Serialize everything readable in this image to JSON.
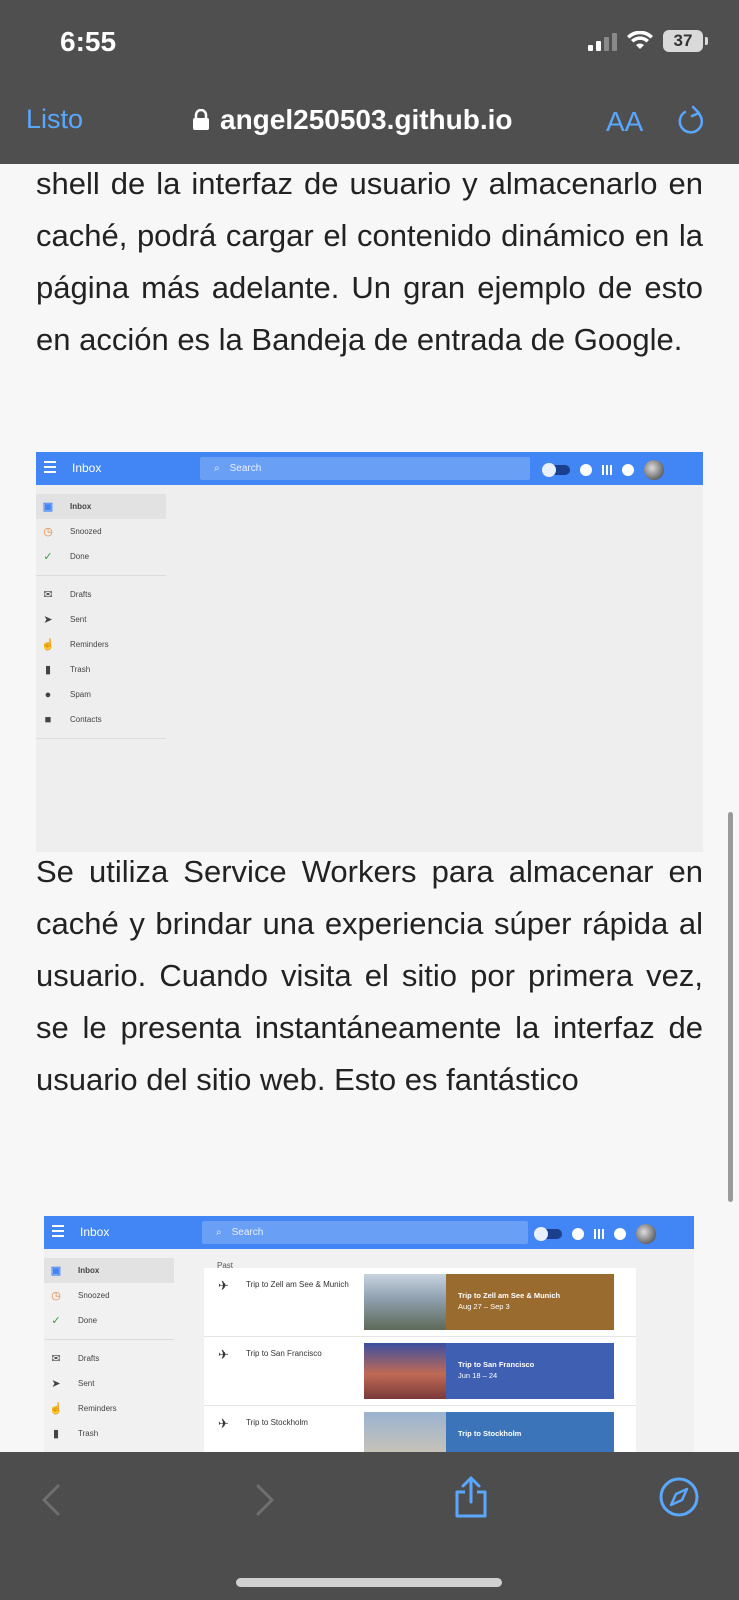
{
  "status_bar": {
    "time": "6:55",
    "battery": "37"
  },
  "browser": {
    "done_label": "Listo",
    "url": "angel250503.github.io",
    "text_size_label": "AA"
  },
  "article": {
    "para1": "shell de la interfaz de usuario y almacenarlo en caché, podrá cargar el contenido dinámico en la página más adelante. Un gran ejemplo de esto en acción es la Bandeja de entrada de Google.",
    "para2": "Se utiliza Service Workers para almacenar en caché y brindar una experiencia súper rápida al usuario. Cuando visita el sitio por primera vez, se le presenta instantáneamente la interfaz de usuario del sitio web. Esto es fantástico"
  },
  "inbox_screenshot_1": {
    "title": "Inbox",
    "search_placeholder": "Search",
    "nav": [
      {
        "label": "Inbox",
        "icon": "inbox-icon"
      },
      {
        "label": "Snoozed",
        "icon": "clock-icon"
      },
      {
        "label": "Done",
        "icon": "check-icon"
      },
      {
        "label": "Drafts",
        "icon": "drafts-icon"
      },
      {
        "label": "Sent",
        "icon": "send-icon"
      },
      {
        "label": "Reminders",
        "icon": "reminder-icon"
      },
      {
        "label": "Trash",
        "icon": "trash-icon"
      },
      {
        "label": "Spam",
        "icon": "spam-icon"
      },
      {
        "label": "Contacts",
        "icon": "contacts-icon"
      }
    ]
  },
  "inbox_screenshot_2": {
    "title": "Inbox",
    "search_placeholder": "Search",
    "nav": [
      {
        "label": "Inbox"
      },
      {
        "label": "Snoozed"
      },
      {
        "label": "Done"
      },
      {
        "label": "Drafts"
      },
      {
        "label": "Sent"
      },
      {
        "label": "Reminders"
      },
      {
        "label": "Trash"
      }
    ],
    "section_label": "Past",
    "trips": [
      {
        "name": "Trip to Zell am See & Munich",
        "card_title": "Trip to Zell am See & Munich",
        "card_dates": "Aug 27 – Sep 3",
        "card_color": "#9a6b2e"
      },
      {
        "name": "Trip to San Francisco",
        "card_title": "Trip to San Francisco",
        "card_dates": "Jun 18 – 24",
        "card_color": "#3f5fb3"
      },
      {
        "name": "Trip to Stockholm",
        "card_title": "Trip to Stockholm",
        "card_dates": "",
        "card_color": "#3b74b8"
      }
    ]
  },
  "colors": {
    "accent": "#5aa7ff",
    "inbox_blue": "#4285f4",
    "toolbar": "#4d4d4d"
  }
}
